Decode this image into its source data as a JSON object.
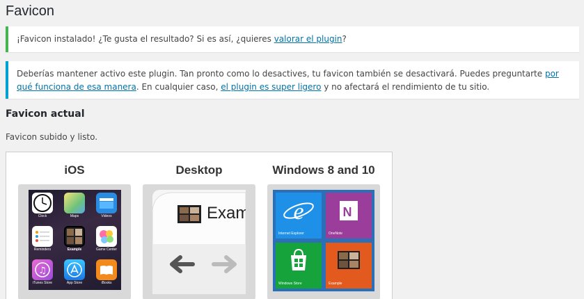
{
  "page": {
    "title": "Favicon"
  },
  "notices": {
    "success": {
      "text_before": "¡Favicon instalado! ¿Te gusta el resultado? Si es así, ¿quieres ",
      "link": "valorar el plugin",
      "text_after": "?"
    },
    "info": {
      "text_1": "Deberías mantener activo este plugin. Tan pronto como lo desactives, tu favicon también se desactivará. Puedes preguntarte ",
      "link_1": "por qué funciona de esa manera",
      "text_2": ". En cualquier caso, ",
      "link_2": "el plugin es super ligero",
      "text_3": " y no afectará el rendimiento de tu sitio."
    }
  },
  "section": {
    "title": "Favicon actual",
    "subtitle": "Favicon subido y listo."
  },
  "preview": {
    "ios": {
      "label": "iOS",
      "apps": [
        "Clock",
        "Maps",
        "Videos",
        "Reminders",
        "Example",
        "Game Center",
        "iTunes Store",
        "App Store",
        "iBooks"
      ]
    },
    "desktop": {
      "label": "Desktop",
      "tab_text": "Exam"
    },
    "windows": {
      "label": "Windows 8 and 10",
      "tiles": [
        "Internet Explorer",
        "OneNote",
        "Windows Store",
        "Example"
      ]
    }
  },
  "colors": {
    "success_border": "#46b450",
    "info_border": "#00a0d2",
    "link": "#0073aa",
    "tile_ie": "#1e90e8",
    "tile_onenote": "#9b3d9a",
    "tile_store": "#16a33c",
    "tile_example": "#e35a1f"
  }
}
